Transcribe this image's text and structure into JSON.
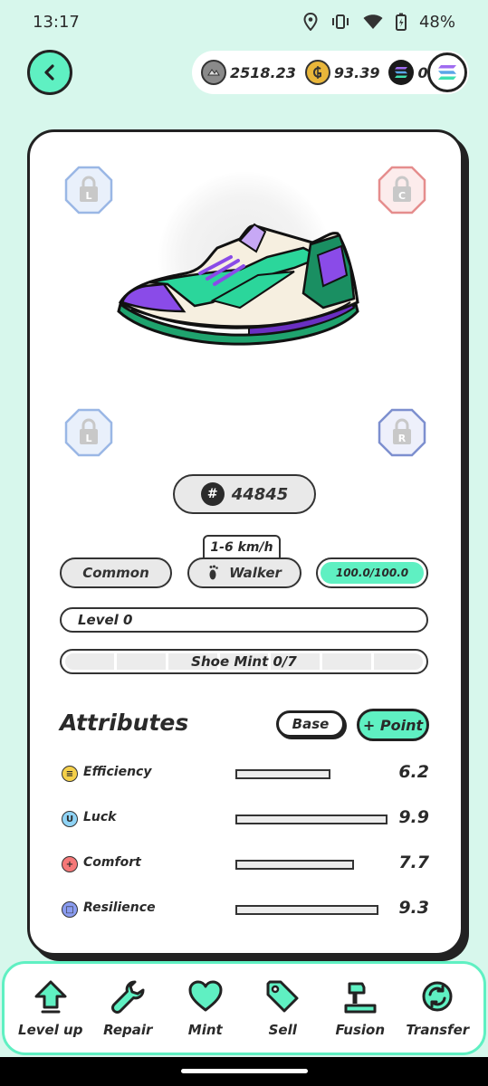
{
  "status_bar": {
    "time": "13:17",
    "battery": "48%"
  },
  "currencies": {
    "gst": "2518.23",
    "gmt": "93.39",
    "sol": "0"
  },
  "sneaker": {
    "id": "44845",
    "speed_range": "1-6 km/h",
    "rarity": "Common",
    "type": "Walker",
    "durability": "100.0/100.0",
    "durability_fraction": 1.0,
    "level": "Level 0",
    "mint": "Shoe Mint 0/7",
    "mint_used": 0,
    "mint_max": 7
  },
  "sockets": {
    "top_left": "L",
    "top_right": "C",
    "bottom_left": "L",
    "bottom_right": "R"
  },
  "attributes": {
    "title": "Attributes",
    "base_label": "Base",
    "point_label": "+ Point",
    "items": [
      {
        "name": "Efficiency",
        "value": "6.2",
        "fraction": 0.62,
        "color": "#f5d04a",
        "glyph": "≡"
      },
      {
        "name": "Luck",
        "value": "9.9",
        "fraction": 0.99,
        "color": "#8fd3f5",
        "glyph": "U"
      },
      {
        "name": "Comfort",
        "value": "7.7",
        "fraction": 0.77,
        "color": "#f57878",
        "glyph": "+"
      },
      {
        "name": "Resilience",
        "value": "9.3",
        "fraction": 0.93,
        "color": "#8a9cf0",
        "glyph": "□"
      }
    ]
  },
  "nav": {
    "items": [
      {
        "label": "Level up",
        "icon": "arrow-up-icon"
      },
      {
        "label": "Repair",
        "icon": "wrench-icon"
      },
      {
        "label": "Mint",
        "icon": "heart-icon"
      },
      {
        "label": "Sell",
        "icon": "tag-icon"
      },
      {
        "label": "Fusion",
        "icon": "hammer-icon"
      },
      {
        "label": "Transfer",
        "icon": "transfer-icon"
      }
    ]
  },
  "colors": {
    "accent": "#5ff0c2",
    "background": "#d7f7ec"
  }
}
